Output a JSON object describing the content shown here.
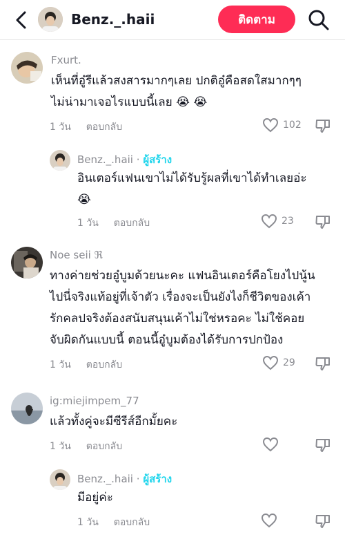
{
  "header": {
    "username": "Benz._.haii",
    "follow_label": "ติดตาม"
  },
  "comments": [
    {
      "username": "Fxurt.",
      "text_line1": "เห็นที่อู๋รีแล้วสงสารมากๆเลย ปกติอู๋คือสดใสมากๆๆ",
      "text_line2": "ไม่น่ามาเจอไรแบบนี้เลย 😭 😭",
      "time": "1 วัน",
      "reply": "ตอบกลับ",
      "likes": "102",
      "replies": [
        {
          "username": "Benz._.haii",
          "creator_label": "ผู้สร้าง",
          "separator": "·",
          "text_line1": "อินเตอร์แฟนเขาไม่ได้รับรู้ผลที่เขาได้ทำเลยอ่ะ",
          "text_line2": "😭",
          "time": "1 วัน",
          "reply": "ตอบกลับ",
          "likes": "23"
        }
      ]
    },
    {
      "username": "Noe seii",
      "username_suffix": "ℜ",
      "text_line1": "ทางค่ายช่วยอู๋บูมด้วยนะคะ แฟนอินเตอร์คือโยงไปนู้น",
      "text_line2": "ไปนี่จริงแท้อยู่ที่เจ้าตัว เรื่องจะเป็นยังไงก็ชีวิตของเค้า",
      "text_line3": "รักคลปจริงต้องสนับสนุนเค้าไม่ใช่หรอคะ ไม่ใช้คอย",
      "text_line4": "จับผิดกันแบบนี้ ตอนนี้อู๋บูมต้องได้รับการปกป้อง",
      "time": "1 วัน",
      "reply": "ตอบกลับ",
      "likes": "29"
    },
    {
      "username": "ig:miejimpem_77",
      "text_line1": "แล้วทั้งคู่จะมีซีรีส์อีกมั้ยคะ",
      "time": "1 วัน",
      "reply": "ตอบกลับ",
      "likes": "",
      "replies": [
        {
          "username": "Benz._.haii",
          "creator_label": "ผู้สร้าง",
          "separator": "·",
          "text_line1": "มีอยู่ค่ะ",
          "time": "1 วัน",
          "reply": "ตอบกลับ",
          "likes": ""
        }
      ]
    }
  ],
  "colors": {
    "accent": "#fe2c55",
    "creator": "#20d5ec",
    "muted": "#8a8b91"
  },
  "icons": {
    "back": "chevron-left-icon",
    "search": "search-icon",
    "like": "heart-icon",
    "dislike": "thumbs-down-icon"
  }
}
